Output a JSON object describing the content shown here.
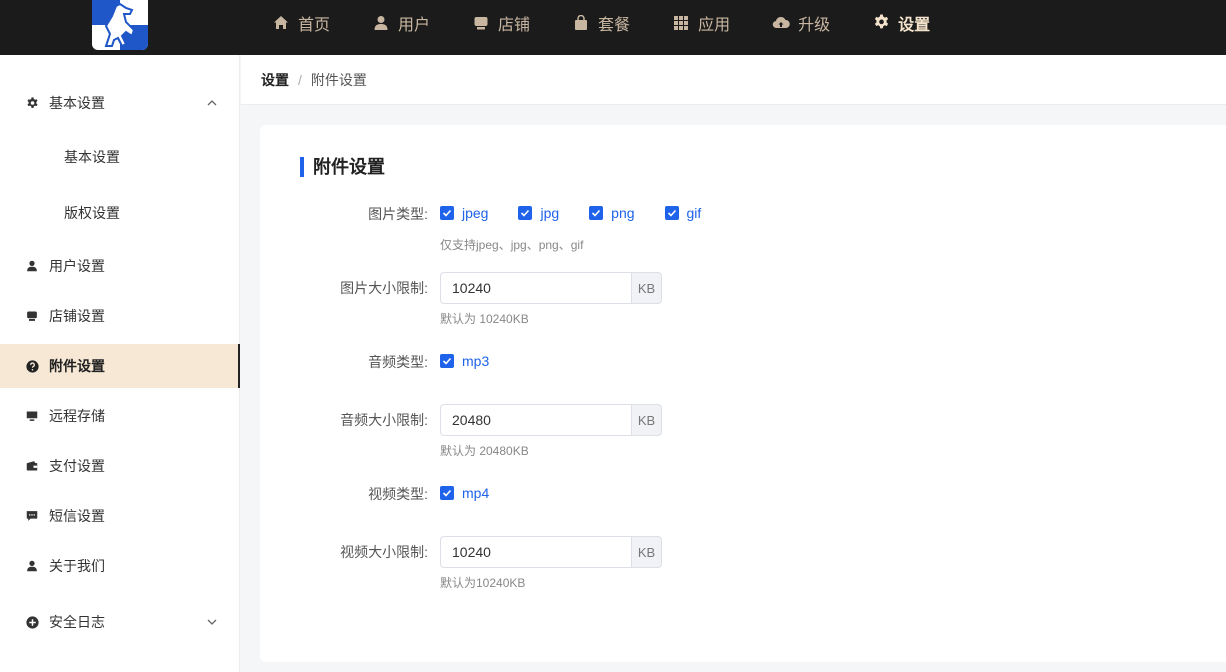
{
  "nav": [
    {
      "label": "首页",
      "icon": "home-icon",
      "active": false
    },
    {
      "label": "用户",
      "icon": "user-icon",
      "active": false
    },
    {
      "label": "店铺",
      "icon": "store-icon",
      "active": false
    },
    {
      "label": "套餐",
      "icon": "bag-icon",
      "active": false
    },
    {
      "label": "应用",
      "icon": "grid-icon",
      "active": false
    },
    {
      "label": "升级",
      "icon": "cloud-upload-icon",
      "active": false
    },
    {
      "label": "设置",
      "icon": "gear-icon",
      "active": true
    }
  ],
  "sidebar": {
    "items": [
      {
        "label": "基本设置",
        "icon": "gear-icon"
      },
      {
        "label": "基本设置"
      },
      {
        "label": "版权设置"
      },
      {
        "label": "用户设置",
        "icon": "user-icon"
      },
      {
        "label": "店铺设置",
        "icon": "store-icon"
      },
      {
        "label": "附件设置",
        "icon": "question-circle-icon"
      },
      {
        "label": "远程存储",
        "icon": "monitor-icon"
      },
      {
        "label": "支付设置",
        "icon": "wallet-icon"
      },
      {
        "label": "短信设置",
        "icon": "message-icon"
      },
      {
        "label": "关于我们",
        "icon": "user-icon"
      },
      {
        "label": "安全日志",
        "icon": "plus-circle-icon"
      }
    ]
  },
  "breadcrumb": {
    "root": "设置",
    "separator": "/",
    "current": "附件设置"
  },
  "card": {
    "title": "附件设置",
    "image_types": {
      "label": "图片类型:",
      "options": [
        "jpeg",
        "jpg",
        "png",
        "gif"
      ],
      "hint": "仅支持jpeg、jpg、png、gif"
    },
    "image_size": {
      "label": "图片大小限制:",
      "value": "10240",
      "unit": "KB",
      "hint": "默认为 10240KB"
    },
    "audio_types": {
      "label": "音频类型:",
      "options": [
        "mp3"
      ]
    },
    "audio_size": {
      "label": "音频大小限制:",
      "value": "20480",
      "unit": "KB",
      "hint": "默认为 20480KB"
    },
    "video_types": {
      "label": "视频类型:",
      "options": [
        "mp4"
      ]
    },
    "video_size": {
      "label": "视频大小限制:",
      "value": "10240",
      "unit": "KB",
      "hint": "默认为10240KB"
    }
  },
  "colors": {
    "accent": "#1e63e9",
    "topbar": "#1b1b1b",
    "sidebar_active": "#f6e8d4",
    "nav_text": "#c8b6a0"
  }
}
